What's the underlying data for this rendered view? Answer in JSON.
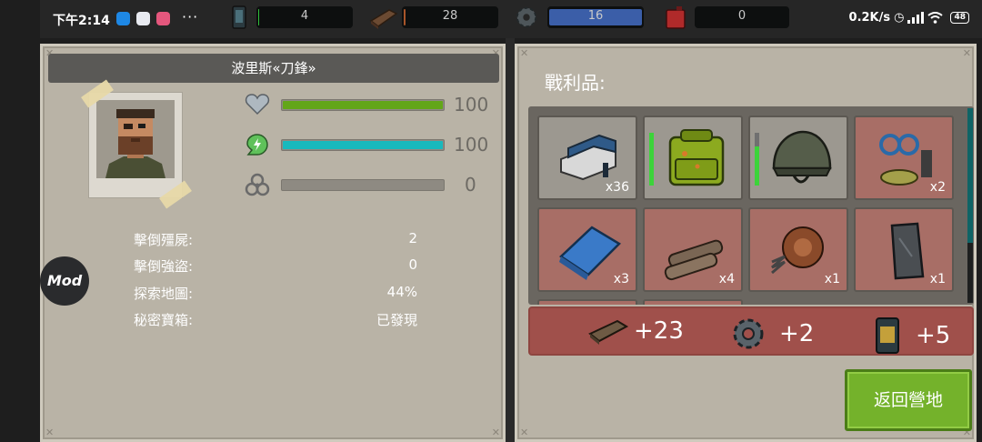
{
  "status_bar": {
    "time": "下午2:14",
    "more": "···",
    "network_speed": "0.2K/s",
    "battery": "48"
  },
  "resources": [
    {
      "name": "battery-cell",
      "value": "4",
      "fill": 0.04,
      "color": "#2fbf3a"
    },
    {
      "name": "wood",
      "value": "28",
      "fill": 0.06,
      "color": "#a8552a"
    },
    {
      "name": "gear",
      "value": "16",
      "fill": 1.0,
      "color": "#3b5ea8"
    },
    {
      "name": "fuel-can",
      "value": "0",
      "fill": 0.0,
      "color": "#b02a2a"
    }
  ],
  "character": {
    "name": "波里斯«刀鋒»",
    "stats": [
      {
        "name": "health",
        "icon": "heart-icon",
        "value": "100",
        "fill": 1.0,
        "color": "#63a619"
      },
      {
        "name": "energy",
        "icon": "energy-icon",
        "value": "100",
        "fill": 1.0,
        "color": "#19b9bd"
      },
      {
        "name": "radiation",
        "icon": "biohazard-icon",
        "value": "0",
        "fill": 0.0,
        "color": "#888"
      }
    ],
    "summary": [
      {
        "label": "擊倒殭屍:",
        "value": "2"
      },
      {
        "label": "擊倒強盜:",
        "value": "0"
      },
      {
        "label": "探索地圖:",
        "value": "44%"
      },
      {
        "label": "秘密寶箱:",
        "value": "已發現"
      }
    ]
  },
  "mod_badge": "Mod",
  "loot": {
    "title": "戰利品:",
    "items": [
      {
        "name": "stapler-item",
        "qty": "x36",
        "bg": "grey"
      },
      {
        "name": "backpack-item",
        "qty": "",
        "bg": "grey",
        "durability": 1.0
      },
      {
        "name": "helmet-item",
        "qty": "",
        "bg": "grey",
        "durability": 0.75
      },
      {
        "name": "wires-item",
        "qty": "x2",
        "bg": "red"
      },
      {
        "name": "cloth-item",
        "qty": "x3",
        "bg": "red"
      },
      {
        "name": "logs-item",
        "qty": "x4",
        "bg": "red"
      },
      {
        "name": "rope-spring-item",
        "qty": "x1",
        "bg": "red"
      },
      {
        "name": "metal-plate-item",
        "qty": "x1",
        "bg": "red"
      }
    ],
    "rewards": [
      {
        "icon": "plank-icon",
        "amount": "+23"
      },
      {
        "icon": "gear-icon",
        "amount": "+2"
      },
      {
        "icon": "battery-icon",
        "amount": "+5"
      }
    ],
    "return_button": "返回營地"
  }
}
